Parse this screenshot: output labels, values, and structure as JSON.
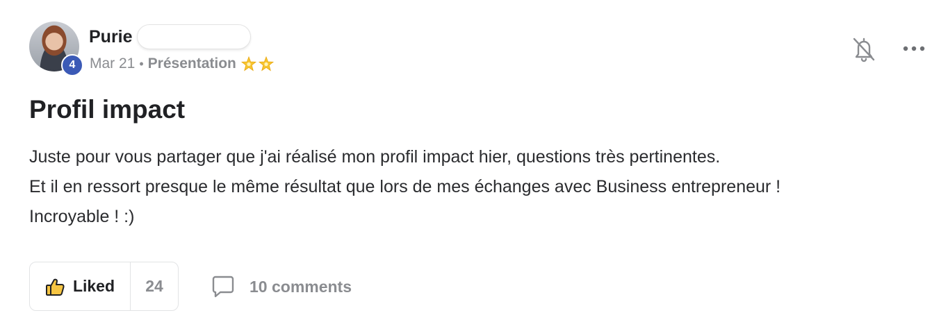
{
  "author": {
    "name": "Purie",
    "level": "4",
    "avatar_icon": "avatar-photo"
  },
  "meta": {
    "date": "Mar 21",
    "separator": "•",
    "category": "Présentation",
    "category_icons": [
      "star-icon",
      "star-icon"
    ]
  },
  "header_actions": {
    "notify_icon": "bell-icon",
    "more_icon": "more-horizontal-icon"
  },
  "post": {
    "title": "Profil impact",
    "body_lines": [
      "Juste pour vous partager que j'ai réalisé mon profil impact hier, questions très pertinentes.",
      "Et il en ressort presque le même résultat que lors de mes échanges avec Business entrepreneur !",
      "Incroyable ! :)"
    ]
  },
  "actions": {
    "like_label": "Liked",
    "like_count": "24",
    "comments_label": "10 comments"
  },
  "colors": {
    "badge": "#3b5ab6",
    "muted_text": "#8a8c90",
    "primary_text": "#202124",
    "border": "#e2e3e5"
  }
}
